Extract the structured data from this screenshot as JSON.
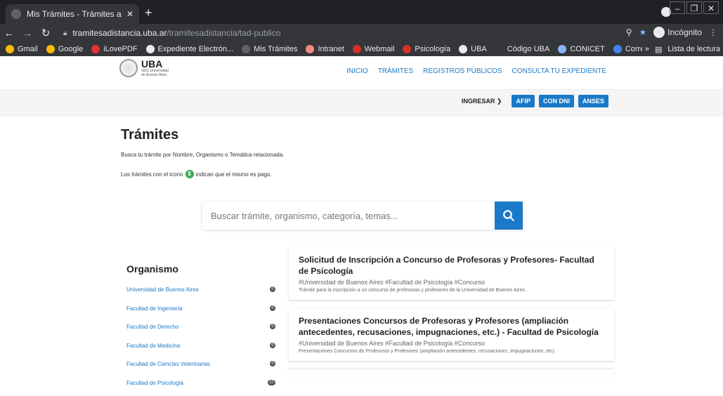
{
  "browser": {
    "tab_title": "Mis Trámites - Trámites a Distanc",
    "url_host": "tramitesadistancia.uba.ar",
    "url_path": "/tramitesadistancia/tad-publico",
    "incognito_label": "Incógnito",
    "bookmarks": [
      {
        "label": "Gmail",
        "color": "#fbbc04"
      },
      {
        "label": "Google",
        "color": "#fbbc04"
      },
      {
        "label": "iLovePDF",
        "color": "#e5322d"
      },
      {
        "label": "Expediente Electrón...",
        "color": "#e8eaed"
      },
      {
        "label": "Mis Trámites",
        "color": "#5f6368"
      },
      {
        "label": "Intranet",
        "color": "#f28b82"
      },
      {
        "label": "Webmail",
        "color": "#d93025"
      },
      {
        "label": "Psicología",
        "color": "#d93025"
      },
      {
        "label": "UBA",
        "color": "#e8eaed"
      },
      {
        "label": "Código UBA",
        "color": "#35363a"
      },
      {
        "label": "CONICET",
        "color": "#8ab4f8"
      },
      {
        "label": "Correo",
        "color": "#4285f4"
      }
    ],
    "overflow_label": "»",
    "reading_list_label": "Lista de lectura"
  },
  "header": {
    "logo_text": "UBA",
    "logo_sub_1": "1821 Universidad",
    "logo_sub_2": "de Buenos Aires",
    "nav": [
      "INICIO",
      "TRÁMITES",
      "REGISTROS PÚBLICOS",
      "CONSULTA TU EXPEDIENTE"
    ]
  },
  "login": {
    "label": "INGRESAR",
    "buttons": [
      "AFIP",
      "CON DNI",
      "ANSES"
    ]
  },
  "main": {
    "title": "Trámites",
    "description": "Busca tu trámite por Nombre, Organismo o Temática relacionada.",
    "paid_note_before": "Los trámites con el icono",
    "paid_icon": "$",
    "paid_note_after": "indican que el mismo es pago.",
    "search_placeholder": "Buscar trámite, organismo, categoría, temas..."
  },
  "organismo": {
    "title": "Organismo",
    "items": [
      {
        "label": "Universidad de Buenos Aires",
        "count": "0"
      },
      {
        "label": "Facultad de Ingeniería",
        "count": "0"
      },
      {
        "label": "Facultad de Derecho",
        "count": "0"
      },
      {
        "label": "Facultad de Medicina",
        "count": "0"
      },
      {
        "label": "Facultad de Ciencias Veterinarias",
        "count": "0"
      },
      {
        "label": "Facultad de Psicología",
        "count": "17"
      }
    ]
  },
  "cards": [
    {
      "title": "Solicitud de Inscripción a Concurso de Profesoras y Profesores- Facultad de Psicología",
      "tags": "#Universidad de Buenos Aires #Facultad de Psicología #Concurso",
      "desc": "Trámite para la inscripción a un concurso de profesoras y profesores de la Universidad de Buenos Aires."
    },
    {
      "title": "Presentaciones Concursos de Profesoras y Profesores (ampliación antecedentes, recusaciones, impugnaciones, etc.) - Facultad de Psicología",
      "tags": "#Universidad de Buenos Aires #Facultad de Psicología #Concurso",
      "desc": "Presentaciones Concursos de Profesoras y Profesores (ampliación antecedentes, recusaciones, impugnaciones, etc)."
    }
  ]
}
